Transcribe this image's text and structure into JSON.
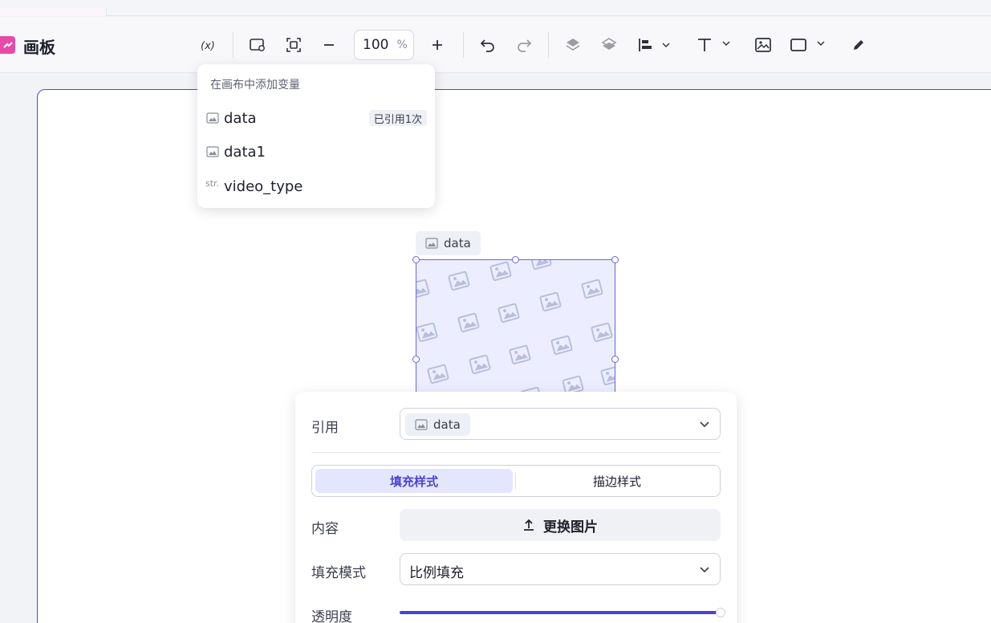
{
  "app": {
    "title": "画板"
  },
  "toolbar": {
    "variable_icon": "variable-icon",
    "zoom_value": "100",
    "zoom_unit": "%"
  },
  "variable_menu": {
    "header": "在画布中添加变量",
    "items": [
      {
        "icon": "image-icon",
        "label": "data",
        "badge": "已引用1次"
      },
      {
        "icon": "image-icon",
        "label": "data1",
        "badge": ""
      },
      {
        "icon_text": "str.",
        "label": "video_type",
        "badge": ""
      }
    ]
  },
  "canvas_element": {
    "tag_label": "data"
  },
  "properties": {
    "reference_label": "引用",
    "reference_value": "data",
    "tabs": {
      "fill": "填充样式",
      "stroke": "描边样式",
      "active": "fill"
    },
    "content_label": "内容",
    "replace_button": "更换图片",
    "fill_mode_label": "填充模式",
    "fill_mode_value": "比例填充",
    "opacity_label": "透明度",
    "opacity": 1.0
  },
  "colors": {
    "accent": "#4a43d4",
    "logo": "#e94aa8"
  }
}
